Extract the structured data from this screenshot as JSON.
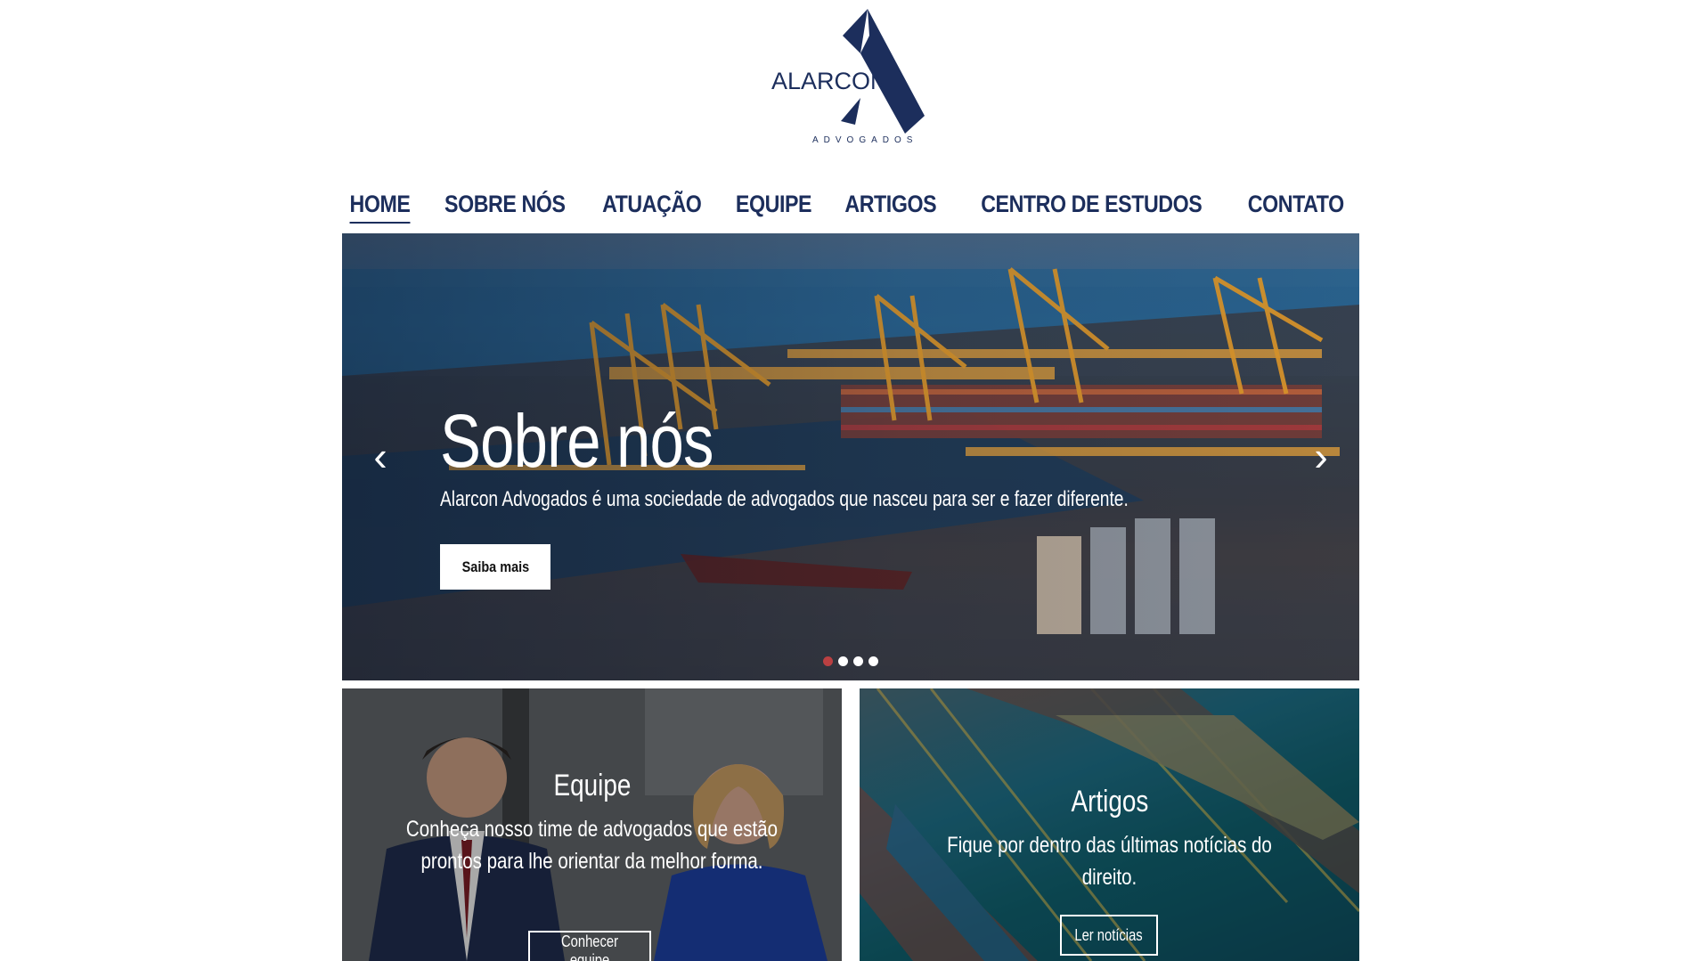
{
  "brand": {
    "name": "ALARCON",
    "tagline": "ADVOGADOS",
    "color": "#1c2e5c"
  },
  "nav": {
    "items": [
      {
        "label": "HOME",
        "active": true
      },
      {
        "label": "SOBRE NÓS",
        "active": false
      },
      {
        "label": "ATUAÇÃO",
        "active": false
      },
      {
        "label": "EQUIPE",
        "active": false
      },
      {
        "label": "ARTIGOS",
        "active": false
      },
      {
        "label": "CENTRO DE ESTUDOS",
        "active": false
      },
      {
        "label": "CONTATO",
        "active": false
      }
    ]
  },
  "hero": {
    "title": "Sobre nós",
    "subtitle": "Alarcon Advogados é uma sociedade de advogados que nasceu para ser e fazer diferente.",
    "button": "Saiba mais",
    "prev_icon": "chevron-left-icon",
    "next_icon": "chevron-right-icon",
    "slides": 4,
    "active_slide": 1
  },
  "cards": {
    "team": {
      "title": "Equipe",
      "text": "Conheça nosso time de advogados que estão prontos para lhe orientar da melhor forma.",
      "button": "Conhecer equipe"
    },
    "articles": {
      "title": "Artigos",
      "text": "Fique por dentro das últimas notícias do direito.",
      "button": "Ler notícias"
    }
  }
}
